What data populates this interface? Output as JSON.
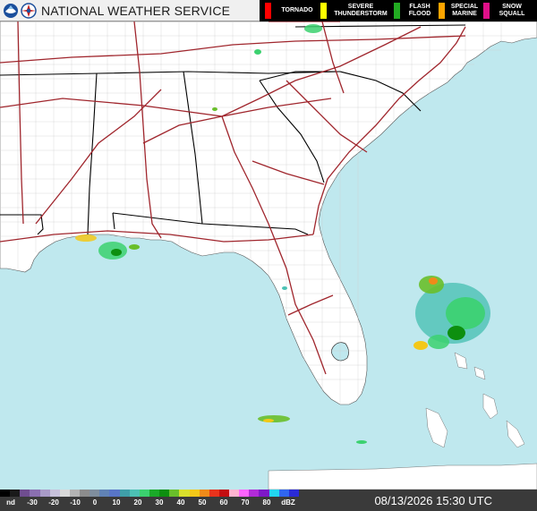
{
  "header": {
    "title": "NATIONAL WEATHER SERVICE",
    "legend": [
      {
        "label": "TORNADO",
        "color": "#ff0000"
      },
      {
        "label": "SEVERE THUNDERSTORM",
        "color": "#ffff00"
      },
      {
        "label": "FLASH FLOOD",
        "color": "#22aa22"
      },
      {
        "label": "SPECIAL MARINE",
        "color": "#ffa500"
      },
      {
        "label": "SNOW SQUALL",
        "color": "#e0108a"
      }
    ]
  },
  "footer": {
    "unit": "dBZ",
    "ticks": [
      "nd",
      "-30",
      "-20",
      "-10",
      "0",
      "10",
      "20",
      "30",
      "40",
      "50",
      "60",
      "70",
      "80"
    ],
    "timestamp": "08/13/2026 15:30 UTC",
    "colors": [
      "#000000",
      "#1a1a1a",
      "#6f4d8f",
      "#8a6fb0",
      "#a99bc8",
      "#c7c1db",
      "#d9d9d9",
      "#b3b3b3",
      "#8c8c8c",
      "#7f8e9e",
      "#6082b5",
      "#5875c8",
      "#3f9fa8",
      "#4cc1b4",
      "#3bd16f",
      "#1aaa28",
      "#0d8f0f",
      "#69bf2a",
      "#d8e02c",
      "#f3c818",
      "#f08a19",
      "#e8331c",
      "#c40d10",
      "#ffb3d0",
      "#ff63ff",
      "#b22bd8",
      "#7e18c7",
      "#22d6f0",
      "#3066f0",
      "#2a2ad6"
    ]
  },
  "map": {
    "ocean_color": "#bfe8ee",
    "land_color": "#ffffff",
    "state_line_color": "#000000",
    "highway_color": "#a0262d"
  }
}
